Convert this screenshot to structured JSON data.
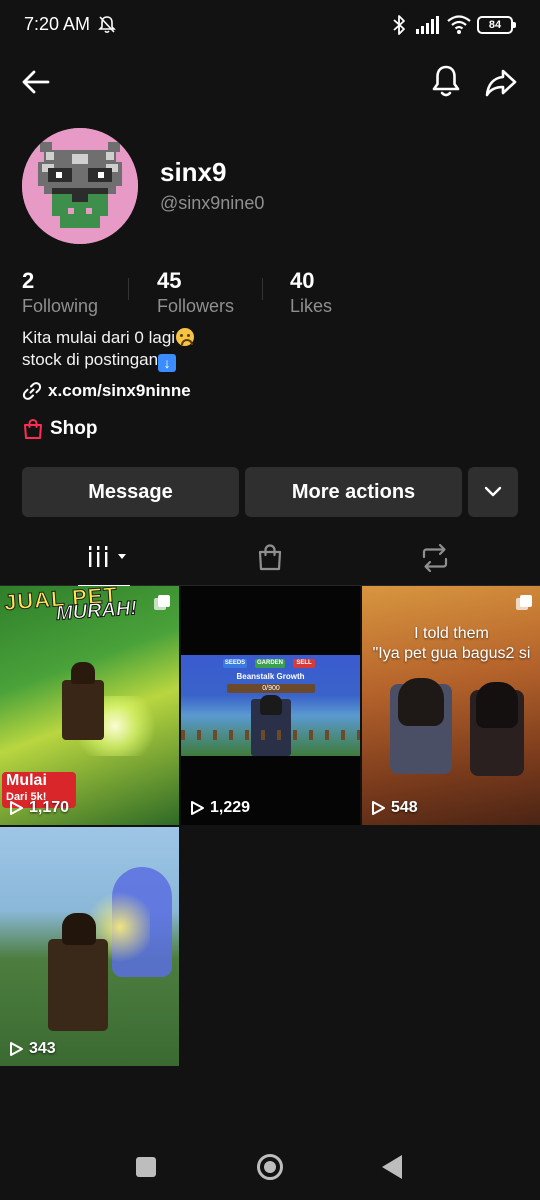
{
  "status_bar": {
    "time": "7:20 AM",
    "battery": "84",
    "icons": [
      "mute-icon",
      "bluetooth-icon",
      "signal-icon",
      "wifi-icon",
      "battery-icon"
    ]
  },
  "header": {
    "icons": [
      "back-arrow-icon",
      "bell-icon",
      "share-icon"
    ]
  },
  "profile": {
    "display_name": "sinx9",
    "username": "@sinx9nine0",
    "stats": {
      "following": {
        "value": "2",
        "label": "Following"
      },
      "followers": {
        "value": "45",
        "label": "Followers"
      },
      "likes": {
        "value": "40",
        "label": "Likes"
      }
    },
    "bio": {
      "line1": "Kita mulai dari 0 lagi",
      "line2": "stock di postingan"
    },
    "link": "x.com/sinx9ninne",
    "shop_label": "Shop"
  },
  "actions": {
    "message": "Message",
    "more_actions": "More actions"
  },
  "tabs": [
    "videos-grid-icon",
    "shop-bag-icon",
    "repost-icon"
  ],
  "videos": [
    {
      "views": "1,170",
      "overlay_title": "JUAL PET",
      "overlay_sub": "MURAH!",
      "badge_title": "Mulai",
      "badge_sub": "Dari 5k!"
    },
    {
      "views": "1,229",
      "tags": [
        "SEEDS",
        "GARDEN",
        "SELL"
      ],
      "game_title": "Beanstalk Growth",
      "progress": "0/900"
    },
    {
      "views": "548",
      "caption_line1": "I told them",
      "caption_line2": "\"Iya pet gua bagus2 si"
    },
    {
      "views": "343"
    }
  ],
  "colors": {
    "background": "#121212",
    "button_bg": "#2f2f2f",
    "secondary_text": "#8f8f8f",
    "shop_red": "#fe2c55",
    "avatar_bg": "#e79ac6"
  }
}
